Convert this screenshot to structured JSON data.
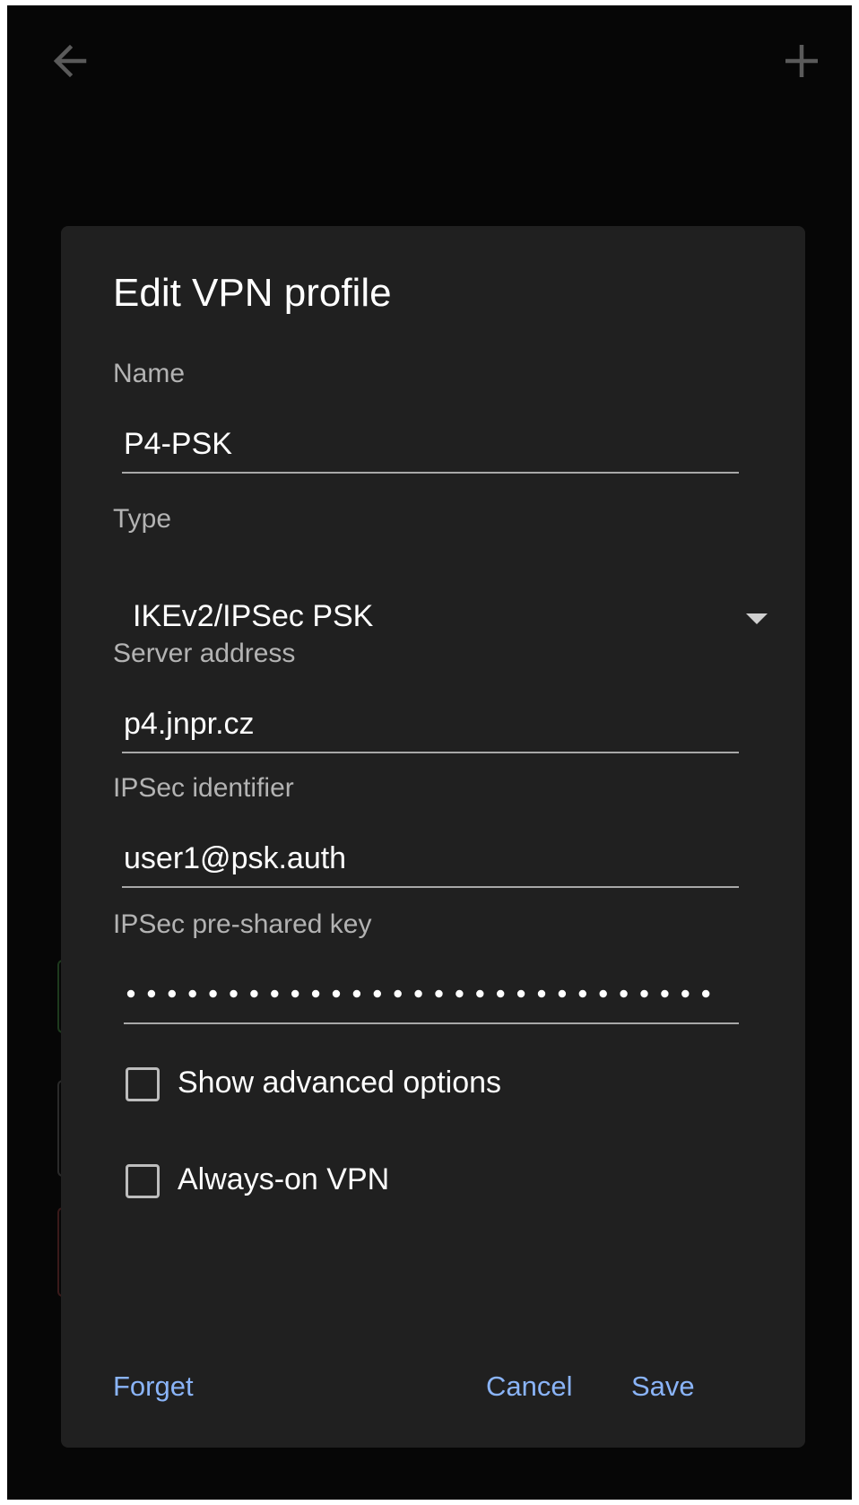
{
  "topbar": {
    "back_icon": "arrow-left-icon",
    "add_icon": "plus-icon"
  },
  "dialog": {
    "title": "Edit VPN profile",
    "fields": {
      "name": {
        "label": "Name",
        "value": "P4-PSK"
      },
      "type": {
        "label": "Type",
        "value": "IKEv2/IPSec PSK"
      },
      "server": {
        "label": "Server address",
        "value": "p4.jnpr.cz"
      },
      "ipsec_id": {
        "label": "IPSec identifier",
        "value": "user1@psk.auth"
      },
      "psk": {
        "label": "IPSec pre-shared key",
        "masked_length": 29
      }
    },
    "checkboxes": {
      "advanced": {
        "label": "Show advanced options",
        "checked": false
      },
      "always_on": {
        "label": "Always-on VPN",
        "checked": false
      }
    },
    "actions": {
      "forget": "Forget",
      "cancel": "Cancel",
      "save": "Save"
    }
  },
  "colors": {
    "background": "#060606",
    "dialog": "#202020",
    "accent": "#8ab4f8"
  }
}
